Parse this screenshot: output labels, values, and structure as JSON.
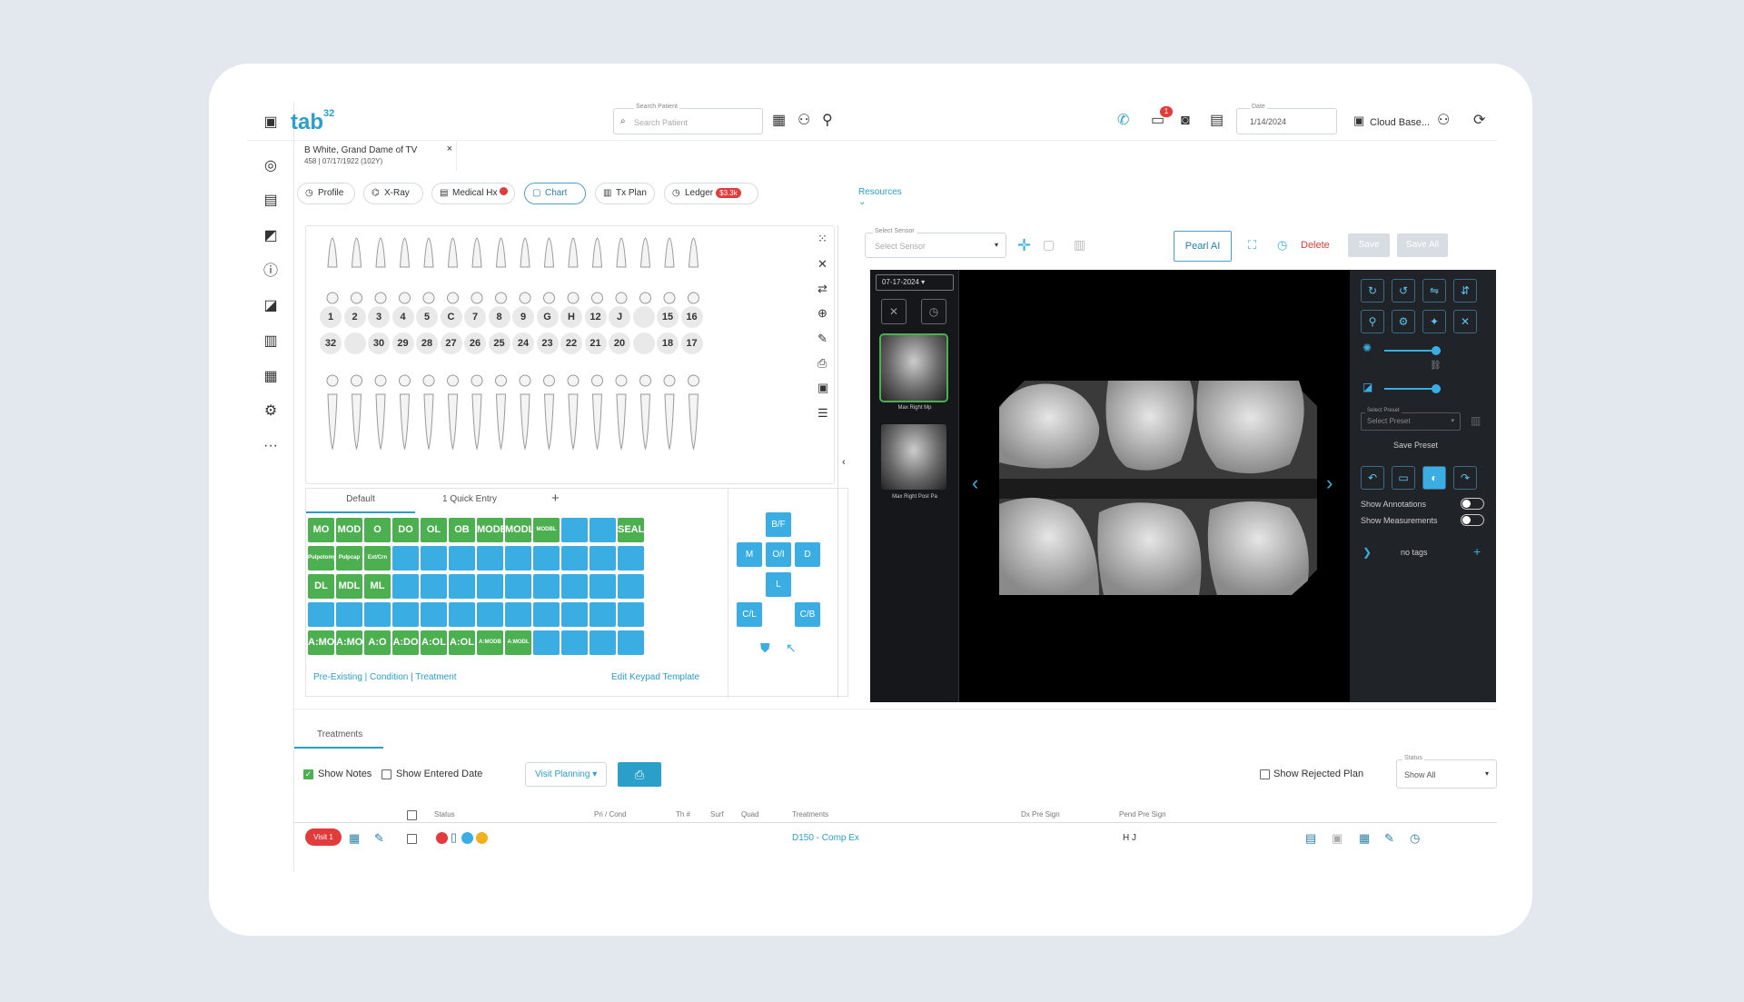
{
  "app": {
    "logo": "tab",
    "logo_sup": "32"
  },
  "sidebar": {
    "icons": [
      "dashboard-icon",
      "chat-icon",
      "chart-icon",
      "info-icon",
      "report-icon",
      "book-icon",
      "billing-icon",
      "settings-icon",
      "more-icon"
    ],
    "more": "···"
  },
  "topbar": {
    "search_label": "Search Patient",
    "search_placeholder": "Search Patient",
    "notif_count": "1",
    "date_label": "Date",
    "date_value": "1/14/2024",
    "location": "Cloud Base..."
  },
  "patient_tab": {
    "name": "B White, Grand Dame of TV",
    "id": "458 | 07/17/1922 (102Y)",
    "close": "×"
  },
  "nav": {
    "profile": "Profile",
    "xray": "X-Ray",
    "medical": "Medical Hx",
    "chart": "Chart",
    "txplan": "Tx Plan",
    "ledger": "Ledger",
    "ledger_badge": "$3.3k",
    "resources": "Resources"
  },
  "chart": {
    "upper_numbers": [
      "1",
      "2",
      "3",
      "4",
      "5",
      "C",
      "7",
      "8",
      "9",
      "G",
      "H",
      "12",
      "J",
      "",
      "15",
      "16"
    ],
    "lower_numbers": [
      "32",
      "",
      "30",
      "29",
      "28",
      "27",
      "26",
      "25",
      "24",
      "23",
      "22",
      "21",
      "20",
      "",
      "18",
      "17"
    ]
  },
  "keypad": {
    "tabs": [
      "Default",
      "1 Quick Entry"
    ],
    "add": "+",
    "rows": [
      [
        {
          "t": "MO",
          "c": "g"
        },
        {
          "t": "MOD",
          "c": "g"
        },
        {
          "t": "O",
          "c": "g"
        },
        {
          "t": "DO",
          "c": "g"
        },
        {
          "t": "OL",
          "c": "g"
        },
        {
          "t": "OB",
          "c": "g"
        },
        {
          "t": "MODB",
          "c": "g"
        },
        {
          "t": "MODL",
          "c": "g"
        },
        {
          "t": "MODBL",
          "c": "g",
          "s": true
        },
        {
          "t": "",
          "c": "b"
        },
        {
          "t": "",
          "c": "b"
        },
        {
          "t": "SEAL",
          "c": "g"
        }
      ],
      [
        {
          "t": "Pulpotomy",
          "c": "g",
          "s": true
        },
        {
          "t": "Pulpcap",
          "c": "g",
          "s": true
        },
        {
          "t": "Ext/Crn",
          "c": "g",
          "s": true
        },
        {
          "t": "",
          "c": "b"
        },
        {
          "t": "",
          "c": "b"
        },
        {
          "t": "",
          "c": "b"
        },
        {
          "t": "",
          "c": "b"
        },
        {
          "t": "",
          "c": "b"
        },
        {
          "t": "",
          "c": "b"
        },
        {
          "t": "",
          "c": "b"
        },
        {
          "t": "",
          "c": "b"
        },
        {
          "t": "",
          "c": "b"
        }
      ],
      [
        {
          "t": "DL",
          "c": "g"
        },
        {
          "t": "MDL",
          "c": "g"
        },
        {
          "t": "ML",
          "c": "g"
        },
        {
          "t": "",
          "c": "b"
        },
        {
          "t": "",
          "c": "b"
        },
        {
          "t": "",
          "c": "b"
        },
        {
          "t": "",
          "c": "b"
        },
        {
          "t": "",
          "c": "b"
        },
        {
          "t": "",
          "c": "b"
        },
        {
          "t": "",
          "c": "b"
        },
        {
          "t": "",
          "c": "b"
        },
        {
          "t": "",
          "c": "b"
        }
      ],
      [
        {
          "t": "",
          "c": "b"
        },
        {
          "t": "",
          "c": "b"
        },
        {
          "t": "",
          "c": "b"
        },
        {
          "t": "",
          "c": "b"
        },
        {
          "t": "",
          "c": "b"
        },
        {
          "t": "",
          "c": "b"
        },
        {
          "t": "",
          "c": "b"
        },
        {
          "t": "",
          "c": "b"
        },
        {
          "t": "",
          "c": "b"
        },
        {
          "t": "",
          "c": "b"
        },
        {
          "t": "",
          "c": "b"
        },
        {
          "t": "",
          "c": "b"
        }
      ],
      [
        {
          "t": "A:MO",
          "c": "g"
        },
        {
          "t": "A:MOD",
          "c": "g"
        },
        {
          "t": "A:O",
          "c": "g"
        },
        {
          "t": "A:DO",
          "c": "g"
        },
        {
          "t": "A:OL",
          "c": "g"
        },
        {
          "t": "A:OL",
          "c": "g"
        },
        {
          "t": "A:MODB",
          "c": "g",
          "s": true
        },
        {
          "t": "A:MODL",
          "c": "g",
          "s": true
        },
        {
          "t": "",
          "c": "b"
        },
        {
          "t": "",
          "c": "b"
        },
        {
          "t": "",
          "c": "b"
        },
        {
          "t": "",
          "c": "b"
        }
      ]
    ],
    "footer_left": "Pre-Existing | Condition | Treatment",
    "footer_right": "Edit Keypad Template",
    "surfaces": {
      "bf": "B/F",
      "m": "M",
      "oi": "O/I",
      "d": "D",
      "l": "L",
      "cl": "C/L",
      "cb": "C/B"
    }
  },
  "xray": {
    "sensor_label": "Select Sensor",
    "sensor_value": "Select Sensor",
    "pearl": "Pearl AI",
    "delete": "Delete",
    "save": "Save",
    "save_all": "Save All",
    "date_label": "Date",
    "date": "07-17-2024",
    "thumbs": [
      "Max Right Mp",
      "Max Right Post Pa"
    ],
    "preset_label": "Select Preset",
    "preset_value": "Select Preset",
    "save_preset": "Save Preset",
    "show_annotations": "Show Annotations",
    "show_measurements": "Show Measurements",
    "no_tags": "no tags",
    "add_tag": "+"
  },
  "treatments": {
    "tab": "Treatments",
    "show_notes": "Show Notes",
    "show_entered_date": "Show Entered Date",
    "visit_planning": "Visit Planning",
    "show_rejected": "Show Rejected Plan",
    "status_label": "Status",
    "status_value": "Show All",
    "headers": {
      "status": "Status",
      "pri": "Pri / Cond",
      "th": "Th #",
      "surf": "Surf",
      "quad": "Quad",
      "treatment": "Treatments",
      "dx": "Dx Pre Sign",
      "pend": "Pend Pre Sign"
    },
    "row": {
      "visit": "Visit 1",
      "treatment": "D150 - Comp Ex",
      "pend": "H J"
    }
  },
  "colors": {
    "accent": "#2a9fc9",
    "green": "#4caf50",
    "blue": "#3aaee3",
    "red": "#e23b3b"
  }
}
